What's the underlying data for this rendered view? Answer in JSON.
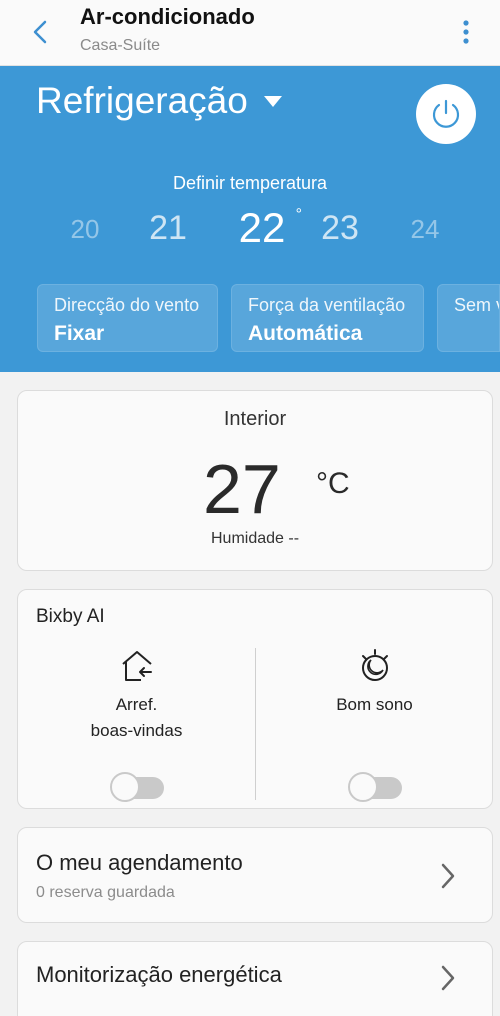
{
  "header": {
    "title": "Ar-condicionado",
    "subtitle": "Casa-Suíte"
  },
  "control": {
    "mode": "Refrigeração",
    "set_temp_label": "Definir temperatura",
    "temps": [
      "20",
      "21",
      "22",
      "23",
      "24"
    ],
    "selected_temp": "22",
    "degree_symbol": "°",
    "chips": [
      {
        "label": "Direcção do vento",
        "value": "Fixar"
      },
      {
        "label": "Força da ventilação",
        "value": "Automática"
      },
      {
        "label": "Sem v",
        "value": ""
      }
    ],
    "accent": "#3d98d6"
  },
  "indoor": {
    "title": "Interior",
    "value": "27",
    "unit": "°C",
    "humidity": "Humidade --"
  },
  "bixby": {
    "title": "Bixby AI",
    "features": [
      {
        "label_line1": "Arref.",
        "label_line2": "boas-vindas",
        "icon": "home-arrow-icon",
        "enabled": false
      },
      {
        "label_line1": "Bom sono",
        "label_line2": "",
        "icon": "sleep-moon-icon",
        "enabled": false
      }
    ]
  },
  "schedule": {
    "title": "O meu agendamento",
    "subtitle": "0 reserva guardada"
  },
  "energy": {
    "title": "Monitorização energética"
  }
}
